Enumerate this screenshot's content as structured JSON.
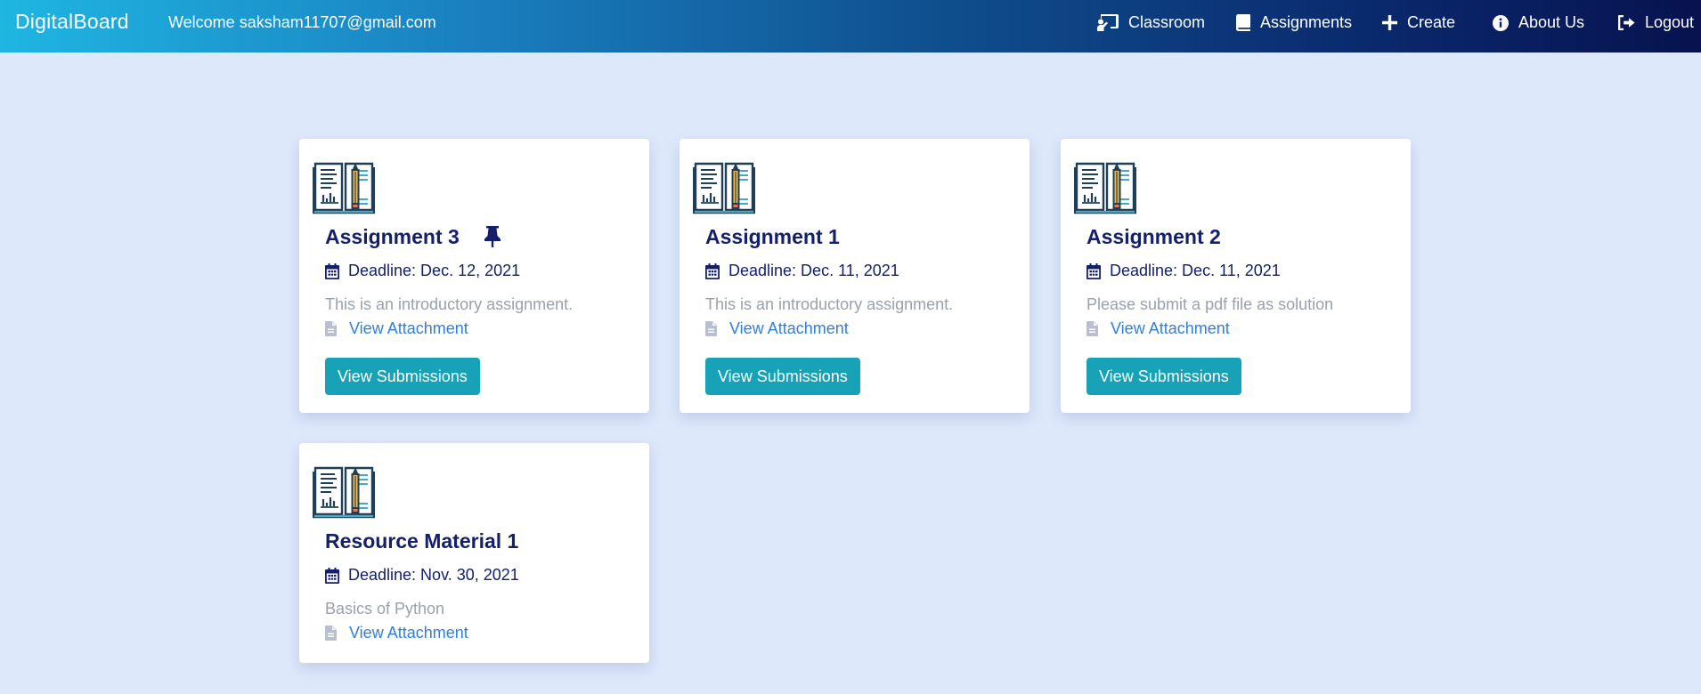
{
  "navbar": {
    "brand": "DigitalBoard",
    "welcome": "Welcome saksham11707@gmail.com",
    "links": [
      {
        "label": "Classroom",
        "icon": "chalkboard-teacher-icon"
      },
      {
        "label": "Assignments",
        "icon": "book-icon"
      },
      {
        "label": "Create",
        "icon": "plus-icon"
      },
      {
        "label": "About Us",
        "icon": "info-circle-icon"
      },
      {
        "label": "Logout",
        "icon": "sign-out-icon"
      }
    ]
  },
  "cards": [
    {
      "title": "Assignment 3",
      "pinned": true,
      "deadline": "Deadline: Dec. 12, 2021",
      "description": "This is an introductory assignment.",
      "attachment_label": "View Attachment",
      "button_label": "View Submissions"
    },
    {
      "title": "Assignment 1",
      "pinned": false,
      "deadline": "Deadline: Dec. 11, 2021",
      "description": "This is an introductory assignment.",
      "attachment_label": "View Attachment",
      "button_label": "View Submissions"
    },
    {
      "title": "Assignment 2",
      "pinned": false,
      "deadline": "Deadline: Dec. 11, 2021",
      "description": "Please submit a pdf file as solution",
      "attachment_label": "View Attachment",
      "button_label": "View Submissions"
    },
    {
      "title": "Resource Material 1",
      "pinned": false,
      "deadline": "Deadline: Nov. 30, 2021",
      "description": "Basics of Python",
      "attachment_label": "View Attachment"
    }
  ],
  "colors": {
    "page_background": "#dde8fb",
    "navbar_gradient_start": "#1fb6e2",
    "navbar_gradient_end": "#07124f",
    "title_text": "#14206b",
    "link": "#2f7fdc",
    "button": "#17a2b8",
    "muted_text": "#9aa0ad"
  }
}
